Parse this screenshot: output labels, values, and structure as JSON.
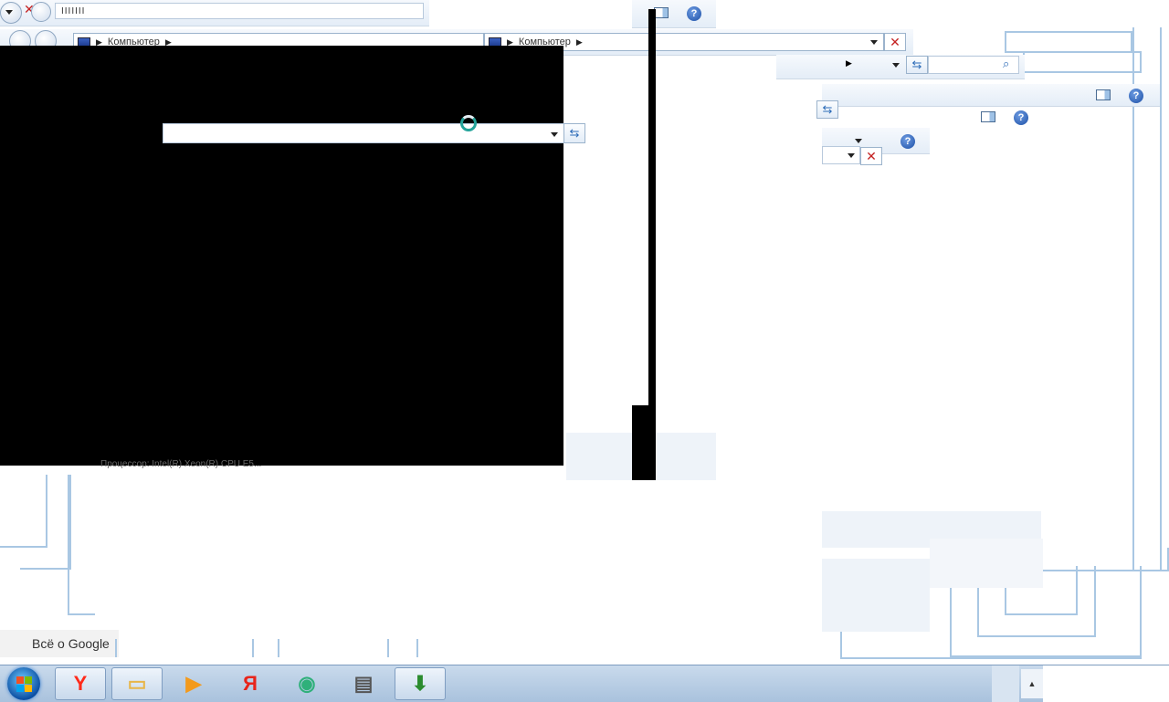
{
  "windows": {
    "address_label": "Компьютер",
    "search_placeholder": "",
    "progress_text": "IIIIIII",
    "help_label": "?"
  },
  "system_info": {
    "processor_text": "Процессор: Intel(R) Xeon(R) CPU E5..."
  },
  "browser": {
    "footer_link": "Всё о Google"
  },
  "taskbar": {
    "start_label": "Start",
    "apps": [
      {
        "name": "yandex-browser-icon",
        "glyph": "Y",
        "color": "#ff2a1a"
      },
      {
        "name": "file-explorer-icon",
        "glyph": "▭",
        "color": "#e8b64a"
      },
      {
        "name": "media-player-icon",
        "glyph": "▶",
        "color": "#f39a1c"
      },
      {
        "name": "yandex-icon",
        "glyph": "Я",
        "color": "#e8241a"
      },
      {
        "name": "messenger-icon",
        "glyph": "◉",
        "color": "#2fb07a"
      },
      {
        "name": "document-icon",
        "glyph": "▤",
        "color": "#555555"
      },
      {
        "name": "internet-download-manager-icon",
        "glyph": "⬇",
        "color": "#2b8c2e"
      }
    ],
    "tray_arrow": "▲"
  }
}
